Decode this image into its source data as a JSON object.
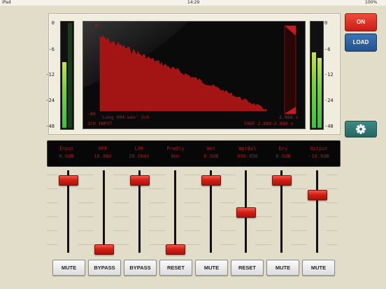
{
  "status": {
    "device": "iPad",
    "time": "14:29",
    "battery": "100%"
  },
  "meters": {
    "left_scale": [
      "0",
      "-6",
      "-12",
      "-24",
      "-48"
    ],
    "right_scale": [
      "0",
      "-6",
      "-12",
      "-24",
      "-48"
    ],
    "left_level_fraction": 0.63,
    "right_levels_fraction": [
      0.72,
      0.67
    ]
  },
  "display": {
    "top_left_label": "0",
    "bottom_left_label": "-80",
    "file_label": "'Long 004.wav' 2ch",
    "input_label": "2CH INPUT",
    "time_label": "2.888 s",
    "fade_label": "FADE 2.888~2.888 s"
  },
  "buttons": {
    "on": "ON",
    "load": "LOAD",
    "settings_icon": "gear-icon"
  },
  "params": [
    {
      "name": "Input",
      "value": "0.0dB"
    },
    {
      "name": "HPF",
      "value": "10.0Hz"
    },
    {
      "name": "LPF",
      "value": "20.0kHz"
    },
    {
      "name": "PreDly",
      "value": "0ms"
    },
    {
      "name": "Wet",
      "value": "0.0dB"
    },
    {
      "name": "WetBal",
      "value": "050:050"
    },
    {
      "name": "Dry",
      "value": "0.0dB"
    },
    {
      "name": "Output",
      "value": "-10.0dB"
    }
  ],
  "faders": [
    {
      "name": "input",
      "level": 0.93
    },
    {
      "name": "hpf",
      "level": 0.0
    },
    {
      "name": "lpf",
      "level": 0.93
    },
    {
      "name": "predelay",
      "level": 0.0
    },
    {
      "name": "wet",
      "level": 0.93
    },
    {
      "name": "wetbal",
      "level": 0.5
    },
    {
      "name": "dry",
      "level": 0.93
    },
    {
      "name": "output",
      "level": 0.74
    }
  ],
  "fader_buttons": [
    "MUTE",
    "BYPASS",
    "BYPASS",
    "RESET",
    "MUTE",
    "RESET",
    "MUTE",
    "MUTE"
  ],
  "colors": {
    "accent_red": "#d41e14",
    "lcd_text": "#b21818",
    "load_blue": "#2d62a0",
    "settings_teal": "#317873"
  }
}
